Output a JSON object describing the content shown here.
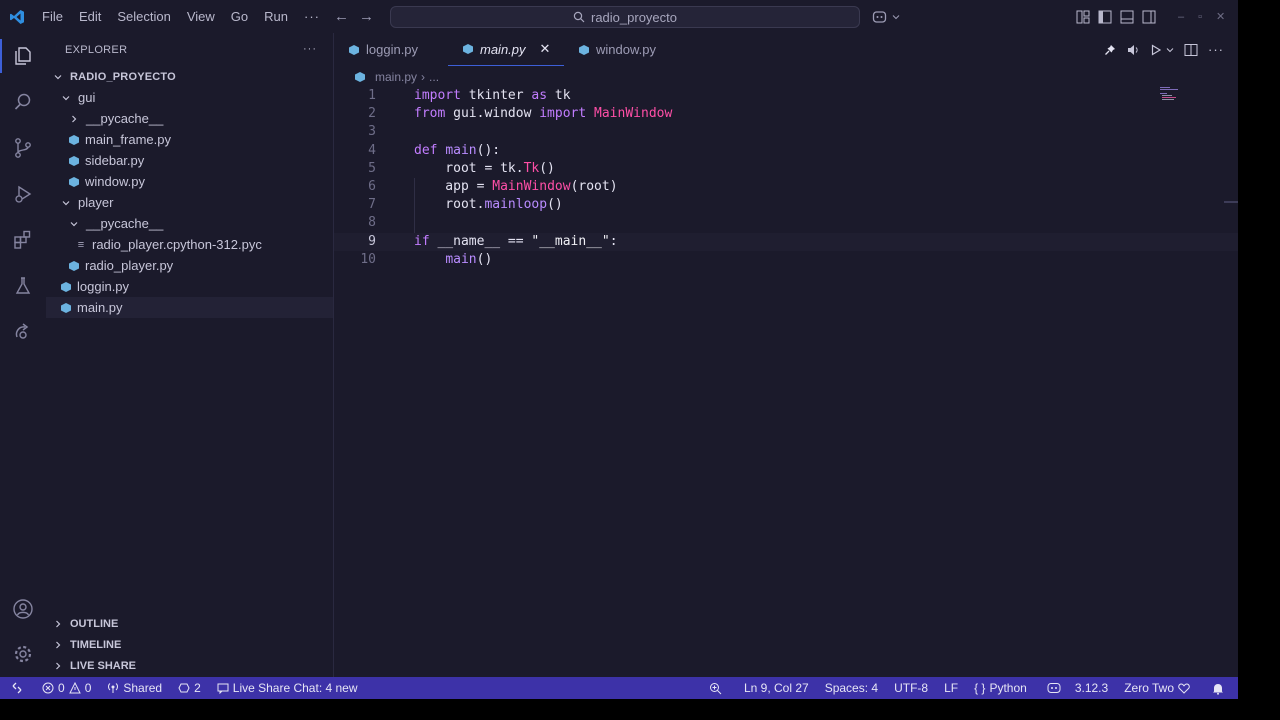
{
  "window": {
    "search": "radio_proyecto",
    "menu": [
      "File",
      "Edit",
      "Selection",
      "View",
      "Go",
      "Run",
      "···"
    ]
  },
  "sidebar": {
    "header": "EXPLORER",
    "more": "···",
    "root": "RADIO_PROYECTO",
    "tree": [
      {
        "label": "gui",
        "type": "folder",
        "open": true,
        "depth": 1
      },
      {
        "label": "__pycache__",
        "type": "folder",
        "open": false,
        "depth": 2
      },
      {
        "label": "main_frame.py",
        "type": "py",
        "depth": 2
      },
      {
        "label": "sidebar.py",
        "type": "py",
        "depth": 2
      },
      {
        "label": "window.py",
        "type": "py",
        "depth": 2
      },
      {
        "label": "player",
        "type": "folder",
        "open": true,
        "depth": 1
      },
      {
        "label": "__pycache__",
        "type": "folder",
        "open": true,
        "depth": 2
      },
      {
        "label": "radio_player.cpython-312.pyc",
        "type": "pyc",
        "depth": 3
      },
      {
        "label": "radio_player.py",
        "type": "py",
        "depth": 2
      },
      {
        "label": "loggin.py",
        "type": "py",
        "depth": 1
      },
      {
        "label": "main.py",
        "type": "py",
        "depth": 1,
        "selected": true
      }
    ],
    "panels": [
      "OUTLINE",
      "TIMELINE",
      "LIVE SHARE"
    ]
  },
  "editor": {
    "tabs": [
      {
        "label": "loggin.py",
        "active": false
      },
      {
        "label": "main.py",
        "active": true
      },
      {
        "label": "window.py",
        "active": false
      }
    ],
    "close": "✕",
    "breadcrumb": {
      "file": "main.py",
      "sep": "›",
      "rest": "..."
    },
    "current_line": 9,
    "lines": [
      {
        "n": "1",
        "tokens": [
          [
            "kw",
            "import "
          ],
          [
            "plain",
            "tkinter "
          ],
          [
            "kw",
            "as "
          ],
          [
            "plain",
            "tk"
          ]
        ]
      },
      {
        "n": "2",
        "tokens": [
          [
            "kw",
            "from "
          ],
          [
            "plain",
            "gui.window "
          ],
          [
            "kw",
            "import "
          ],
          [
            "cls",
            "MainWindow"
          ]
        ]
      },
      {
        "n": "3",
        "tokens": []
      },
      {
        "n": "4",
        "tokens": [
          [
            "kw",
            "def "
          ],
          [
            "fn",
            "main"
          ],
          [
            "plain",
            "():"
          ]
        ]
      },
      {
        "n": "5",
        "tokens": [
          [
            "plain",
            "    root = tk."
          ],
          [
            "cls",
            "Tk"
          ],
          [
            "plain",
            "()"
          ]
        ]
      },
      {
        "n": "6",
        "tokens": [
          [
            "plain",
            "    app = "
          ],
          [
            "cls",
            "MainWindow"
          ],
          [
            "plain",
            "(root)"
          ]
        ]
      },
      {
        "n": "7",
        "tokens": [
          [
            "plain",
            "    root."
          ],
          [
            "fn",
            "mainloop"
          ],
          [
            "plain",
            "()"
          ]
        ]
      },
      {
        "n": "8",
        "tokens": []
      },
      {
        "n": "9",
        "tokens": [
          [
            "kw",
            "if "
          ],
          [
            "plain",
            "__name__ == "
          ],
          [
            "str",
            "\"__main__\""
          ],
          [
            "plain",
            ":"
          ]
        ]
      },
      {
        "n": "10",
        "tokens": [
          [
            "plain",
            "    "
          ],
          [
            "fn",
            "main"
          ],
          [
            "plain",
            "()"
          ]
        ]
      }
    ]
  },
  "status": {
    "errors": "0",
    "warnings": "0",
    "shared": "Shared",
    "ports": "2",
    "live_share_chat": "Live Share Chat: 4 new",
    "position": "Ln 9, Col 27",
    "spaces": "Spaces: 4",
    "encoding": "UTF-8",
    "eol": "LF",
    "language": "Python",
    "python_version": "3.12.3",
    "theme": "Zero Two"
  },
  "colors": {
    "background": "#1b1a2b",
    "statusbar": "#3d32a8",
    "accent": "#3d5fd8",
    "keyword": "#c27dff",
    "class": "#ff4fa7"
  }
}
